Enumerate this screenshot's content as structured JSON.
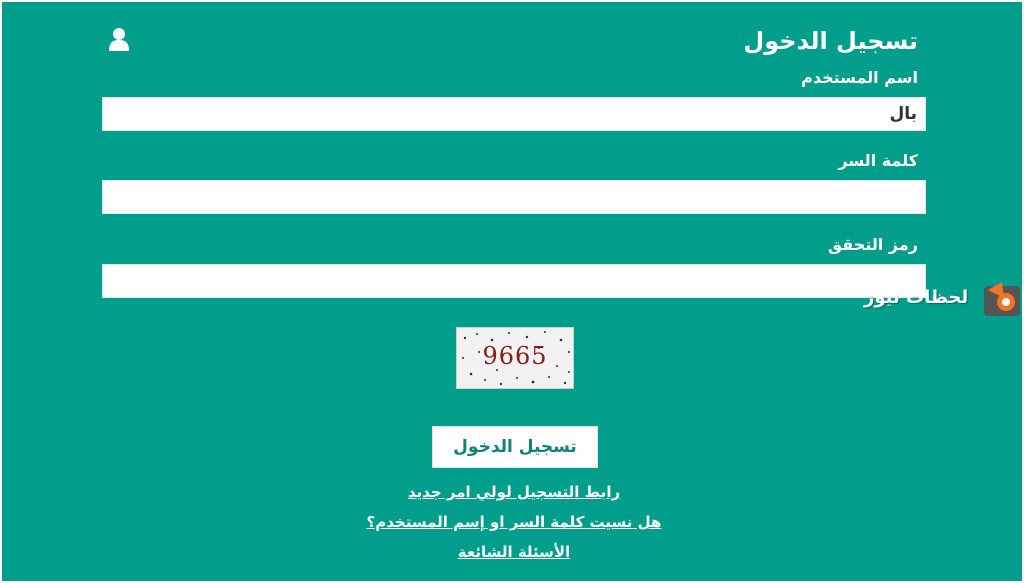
{
  "colors": {
    "background": "#009e8b",
    "button_text": "#0d8476",
    "captcha_text": "#8b1a1a"
  },
  "header": {
    "title": "تسجيل الدخول",
    "icon": "user-icon"
  },
  "form": {
    "username_label": "اسم المستخدم",
    "username_value": "بال",
    "password_label": "كلمة السر",
    "password_value": "",
    "captcha_label": "رمز التحقق",
    "captcha_value": "",
    "captcha_image_text": "9665",
    "submit_label": "تسجيل الدخول"
  },
  "links": {
    "register_parent": "رابط التسجيل لولي امر جديد",
    "forgot": "هل نسيت كلمة السر او إسم المستخدم؟",
    "faq": "الأسئلة الشائعة"
  },
  "watermark": {
    "text": "لحظات نيوز",
    "icon": "logo-icon"
  }
}
